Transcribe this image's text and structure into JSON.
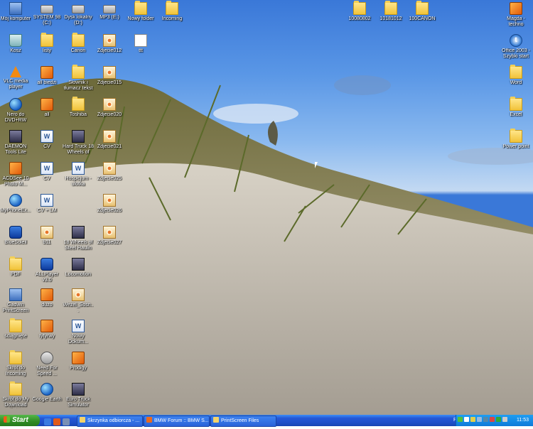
{
  "desktop_icons": [
    {
      "label": "Mój komputer",
      "type": "pc",
      "icon": "computer-icon"
    },
    {
      "label": "SYSTEM 98 (C:)",
      "type": "drive",
      "icon": "hard-drive-icon"
    },
    {
      "label": "Dysk lokalny (D:)",
      "type": "drive",
      "icon": "hard-drive-icon"
    },
    {
      "label": "MP3 (E:)",
      "type": "drive",
      "icon": "hard-drive-icon"
    },
    {
      "label": "Nowy folder",
      "type": "folder",
      "icon": "folder-icon"
    },
    {
      "label": "Incoming",
      "type": "folder",
      "icon": "folder-icon"
    },
    {
      "label": "10080802",
      "type": "folder",
      "icon": "folder-icon"
    },
    {
      "label": "10181012",
      "type": "folder",
      "icon": "folder-icon"
    },
    {
      "label": "100CANON",
      "type": "folder",
      "icon": "folder-icon"
    },
    {
      "label": "Magda - techno",
      "type": "shortcut",
      "icon": "shortcut-icon"
    },
    {
      "label": "Kosz",
      "type": "bin",
      "icon": "recycle-bin-icon"
    },
    {
      "label": "listy",
      "type": "folder",
      "icon": "folder-icon"
    },
    {
      "label": "Canon",
      "type": "folder",
      "icon": "folder-icon"
    },
    {
      "label": "Zdjecie012",
      "type": "img",
      "icon": "image-file-icon"
    },
    {
      "label": "ttt",
      "type": "doc",
      "icon": "text-file-icon"
    },
    {
      "label": "Office 2003 - Szybki start",
      "type": "office",
      "icon": "office-icon"
    },
    {
      "label": "VLC media player",
      "type": "vlc",
      "icon": "vlc-icon"
    },
    {
      "label": "all biedzi",
      "type": "shortcut",
      "icon": "shortcut-icon"
    },
    {
      "label": "Słownik i tłumacz tekst",
      "type": "folder",
      "icon": "folder-icon"
    },
    {
      "label": "Zdjecie015",
      "type": "img",
      "icon": "image-file-icon"
    },
    {
      "label": "Word",
      "type": "folder",
      "icon": "folder-icon"
    },
    {
      "label": "Nero do DVD+RW",
      "type": "globe",
      "icon": "nero-icon"
    },
    {
      "label": "all",
      "type": "shortcut",
      "icon": "shortcut-icon"
    },
    {
      "label": "Toshiba",
      "type": "folder",
      "icon": "folder-icon"
    },
    {
      "label": "Zdjecie020",
      "type": "img",
      "icon": "image-file-icon"
    },
    {
      "label": "Excel",
      "type": "folder",
      "icon": "folder-icon"
    },
    {
      "label": "DAEMON Tools Lite",
      "type": "app",
      "icon": "daemon-tools-icon"
    },
    {
      "label": "CV",
      "type": "word",
      "icon": "word-doc-icon"
    },
    {
      "label": "Hard Truck 18 Wheels of",
      "type": "app",
      "icon": "game-icon"
    },
    {
      "label": "Zdjecie021",
      "type": "img",
      "icon": "image-file-icon"
    },
    {
      "label": "Power point",
      "type": "folder",
      "icon": "folder-icon"
    },
    {
      "label": "ACDSee 10 Photo M...",
      "type": "shortcut",
      "icon": "acdsee-icon"
    },
    {
      "label": "CV",
      "type": "word",
      "icon": "word-doc-icon"
    },
    {
      "label": "Hospicjum - ulotka",
      "type": "word",
      "icon": "word-doc-icon"
    },
    {
      "label": "Zdjecie025",
      "type": "img",
      "icon": "image-file-icon"
    },
    {
      "label": "MyPhoneEx...",
      "type": "globe",
      "icon": "phone-icon"
    },
    {
      "label": "CV + LM",
      "type": "word",
      "icon": "word-doc-icon"
    },
    {
      "label": "Zdjecie026",
      "type": "img",
      "icon": "image-file-icon"
    },
    {
      "label": "BlueSoleil",
      "type": "bt",
      "icon": "bluetooth-icon"
    },
    {
      "label": "b11",
      "type": "img",
      "icon": "image-file-icon"
    },
    {
      "label": "18 Wheels of Steel Haulin",
      "type": "app",
      "icon": "game-icon"
    },
    {
      "label": "Zdjecie027",
      "type": "img",
      "icon": "image-file-icon"
    },
    {
      "label": "PDF",
      "type": "folder",
      "icon": "folder-icon"
    },
    {
      "label": "ALLPlayer v3.0",
      "type": "bt",
      "icon": "allplayer-icon"
    },
    {
      "label": "Locomotion",
      "type": "app",
      "icon": "game-icon"
    },
    {
      "label": "Gadwin PrintScreen",
      "type": "pc",
      "icon": "printscreen-icon"
    },
    {
      "label": "duzo",
      "type": "shortcut",
      "icon": "shortcut-icon"
    },
    {
      "label": "Wezel_Sosn...",
      "type": "img",
      "icon": "image-file-icon"
    },
    {
      "label": "ściągnięte",
      "type": "folder",
      "icon": "folder-icon"
    },
    {
      "label": "tytyrwy",
      "type": "shortcut",
      "icon": "shortcut-icon"
    },
    {
      "label": "Nowy Dokum...",
      "type": "word",
      "icon": "word-doc-icon"
    },
    {
      "label": "Skrót do Incoming",
      "type": "folder",
      "icon": "folder-icon"
    },
    {
      "label": "Need For Speed ...",
      "type": "mp3",
      "icon": "game-icon"
    },
    {
      "label": "Prodigy",
      "type": "shortcut",
      "icon": "shortcut-icon"
    },
    {
      "label": "Skrót do My Download Files",
      "type": "folder",
      "icon": "folder-icon"
    },
    {
      "label": "Google Earth",
      "type": "globe",
      "icon": "google-earth-icon"
    },
    {
      "label": "Euro Truck Simulator",
      "type": "app",
      "icon": "game-icon"
    }
  ],
  "taskbar": {
    "start_label": "Start",
    "buttons": [
      {
        "label": "Skrzynka odbiorcza - ..."
      },
      {
        "label": "BMW Forum :: BMW S..."
      },
      {
        "label": "PrintScreen Files"
      }
    ],
    "language": "PL",
    "clock": "11:53"
  },
  "colors": {
    "taskbar": "#2557d6",
    "start": "#2f8a23",
    "tray": "#0f7ad8",
    "sky": "#3a78d8",
    "sand": "#c9c3b8"
  }
}
